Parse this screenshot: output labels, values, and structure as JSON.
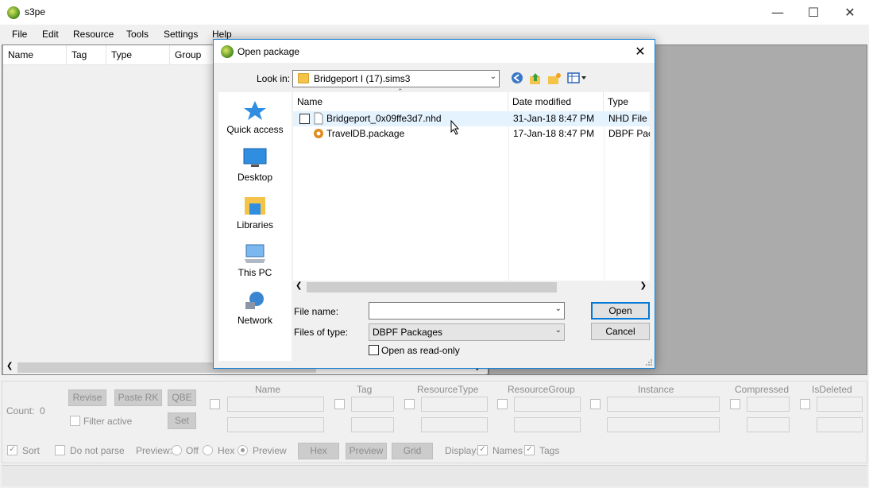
{
  "window": {
    "title": "s3pe",
    "minimize": "—",
    "maximize": "☐",
    "close": "✕"
  },
  "menu": [
    "File",
    "Edit",
    "Resource",
    "Tools",
    "Settings",
    "Help"
  ],
  "grid_columns": [
    "Name",
    "Tag",
    "Type",
    "Group"
  ],
  "bottom": {
    "count_label": "Count:",
    "count_value": "0",
    "revise": "Revise",
    "paste_rk": "Paste RK",
    "qbe": "QBE",
    "filter_active": "Filter active",
    "set": "Set",
    "filter_headers": [
      "Name",
      "Tag",
      "ResourceType",
      "ResourceGroup",
      "Instance",
      "Compressed",
      "IsDeleted"
    ],
    "sort": "Sort",
    "do_not_parse": "Do not parse",
    "preview_label": "Preview:",
    "preview_off": "Off",
    "preview_hex": "Hex",
    "preview_preview": "Preview",
    "btn_hex": "Hex",
    "btn_preview": "Preview",
    "btn_grid": "Grid",
    "display_label": "Display:",
    "display_names": "Names",
    "display_tags": "Tags"
  },
  "dialog": {
    "title": "Open package",
    "close": "✕",
    "look_in_label": "Look in:",
    "look_in_value": "Bridgeport I (17).sims3",
    "places": [
      "Quick access",
      "Desktop",
      "Libraries",
      "This PC",
      "Network"
    ],
    "columns": [
      "Name",
      "Date modified",
      "Type"
    ],
    "files": [
      {
        "name": "Bridgeport_0x09ffe3d7.nhd",
        "date": "31-Jan-18 8:47 PM",
        "type": "NHD File"
      },
      {
        "name": "TravelDB.package",
        "date": "17-Jan-18 8:47 PM",
        "type": "DBPF Pacl"
      }
    ],
    "file_name_label": "File name:",
    "file_name_value": "",
    "files_of_type_label": "Files of type:",
    "files_of_type_value": "DBPF Packages",
    "open_readonly": "Open as read-only",
    "open_button": "Open",
    "cancel_button": "Cancel"
  },
  "colors": {
    "dialog_border": "#1883d7",
    "selection": "#e5f3ff",
    "default_button_border": "#0078d7"
  }
}
